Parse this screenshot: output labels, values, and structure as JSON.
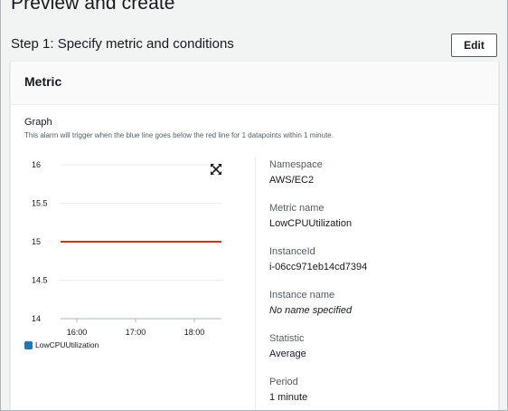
{
  "page": {
    "title": "Preview and create",
    "step_title": "Step 1: Specify metric and conditions",
    "edit_label": "Edit"
  },
  "metric_card": {
    "title": "Metric",
    "graph_label": "Graph",
    "graph_description": "This alarm will trigger when the blue line goes below the red line for 1 datapoints within 1 minute."
  },
  "chart_data": {
    "type": "line",
    "title": "",
    "xlabel": "",
    "ylabel": "",
    "x_ticks": [
      "16:00",
      "17:00",
      "18:00"
    ],
    "y_ticks": [
      "16",
      "15.5",
      "15",
      "14.5",
      "14"
    ],
    "ylim": [
      14,
      16
    ],
    "grid": true,
    "threshold": {
      "value": 15,
      "color": "#d13212"
    },
    "series": [
      {
        "name": "LowCPUUtilization",
        "color": "#1f77b4",
        "values": []
      }
    ],
    "legend": "bottom-left"
  },
  "details": [
    {
      "label": "Namespace",
      "value": "AWS/EC2",
      "italic": false
    },
    {
      "label": "Metric name",
      "value": "LowCPUUtilization",
      "italic": false
    },
    {
      "label": "InstanceId",
      "value": "i-06cc971eb14cd7394",
      "italic": false
    },
    {
      "label": "Instance name",
      "value": "No name specified",
      "italic": true
    },
    {
      "label": "Statistic",
      "value": "Average",
      "italic": false
    },
    {
      "label": "Period",
      "value": "1 minute",
      "italic": false
    }
  ],
  "icons": {
    "expand": "expand-icon"
  },
  "colors": {
    "accent": "#0073bb",
    "threshold": "#d13212",
    "series": "#1f77b4"
  }
}
